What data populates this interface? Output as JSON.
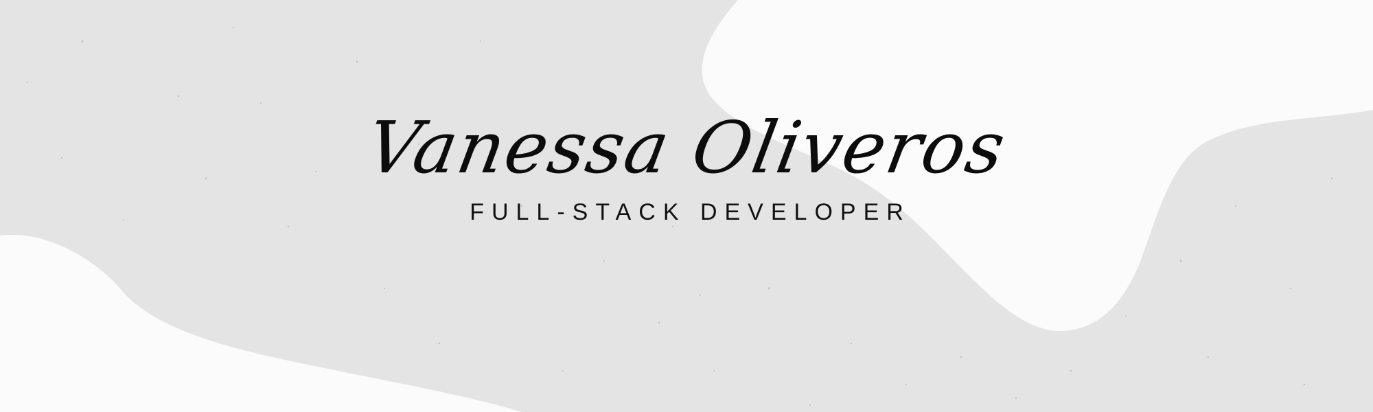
{
  "banner": {
    "name": "Vanessa Oliveros",
    "subtitle": "FULL-STACK DEVELOPER"
  },
  "colors": {
    "paper": "#e4e4e4",
    "blob": "#fbfbfb",
    "text": "#0c0c0c"
  }
}
